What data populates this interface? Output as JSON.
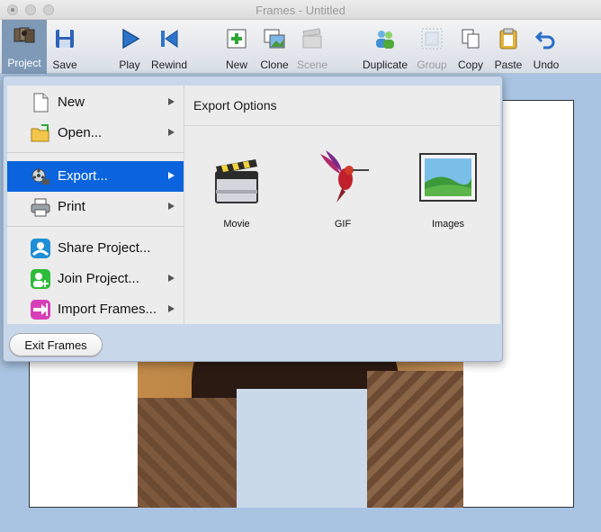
{
  "window": {
    "title": "Frames - Untitled"
  },
  "toolbar": {
    "items": [
      {
        "label": "Project",
        "icon": "project-icon",
        "active": true
      },
      {
        "label": "Save",
        "icon": "floppy-disk-icon"
      },
      {
        "label": "Play",
        "icon": "play-icon"
      },
      {
        "label": "Rewind",
        "icon": "rewind-icon"
      },
      {
        "label": "New",
        "icon": "new-frame-icon"
      },
      {
        "label": "Clone",
        "icon": "clone-icon"
      },
      {
        "label": "Scene",
        "icon": "clapper-icon",
        "disabled": true
      },
      {
        "label": "Duplicate",
        "icon": "duplicate-people-icon"
      },
      {
        "label": "Group",
        "icon": "group-icon",
        "disabled": true
      },
      {
        "label": "Copy",
        "icon": "copy-icon"
      },
      {
        "label": "Paste",
        "icon": "clipboard-icon"
      },
      {
        "label": "Undo",
        "icon": "undo-icon"
      }
    ]
  },
  "project_menu": {
    "items": [
      {
        "label": "New",
        "icon": "document-icon",
        "submenu": true
      },
      {
        "label": "Open...",
        "icon": "folder-open-icon",
        "submenu": true
      },
      {
        "label": "Export...",
        "icon": "film-reel-icon",
        "submenu": true,
        "selected": true
      },
      {
        "label": "Print",
        "icon": "printer-icon",
        "submenu": true
      },
      {
        "label": "Share Project...",
        "icon": "share-person-icon",
        "submenu": false
      },
      {
        "label": "Join Project...",
        "icon": "add-person-icon",
        "submenu": true
      },
      {
        "label": "Import Frames...",
        "icon": "import-arrow-icon",
        "submenu": true
      }
    ],
    "exit_label": "Exit Frames"
  },
  "export_submenu": {
    "title": "Export Options",
    "options": [
      {
        "label": "Movie",
        "icon": "movie-clapper-icon"
      },
      {
        "label": "GIF",
        "icon": "hummingbird-icon"
      },
      {
        "label": "Images",
        "icon": "landscape-image-icon"
      }
    ]
  },
  "colors": {
    "selection": "#0b64dd",
    "window_background": "#a9c4e3",
    "menu_background": "#ececec"
  }
}
